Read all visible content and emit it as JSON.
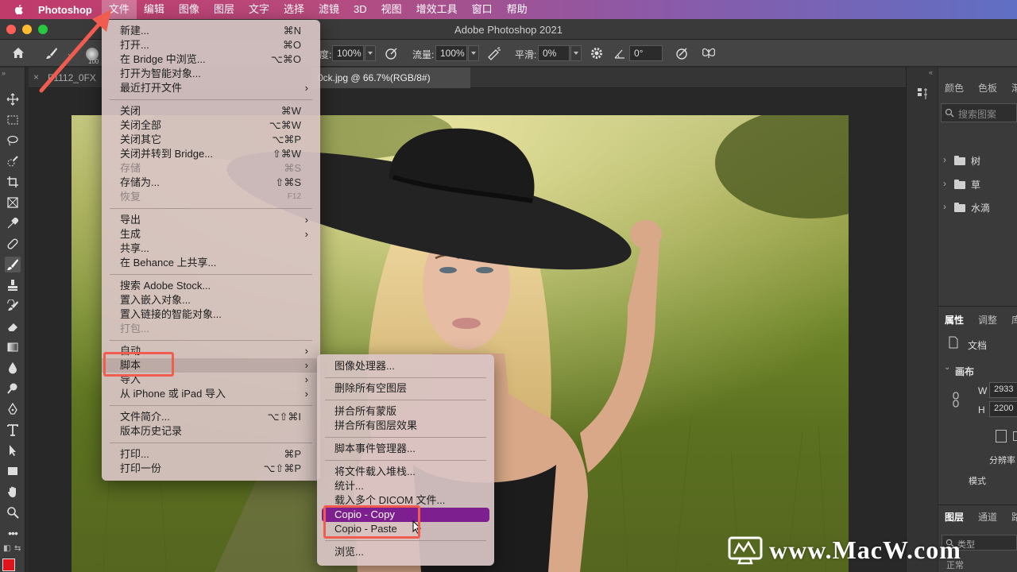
{
  "menubar": {
    "app_name": "Photoshop",
    "items": [
      "文件",
      "编辑",
      "图像",
      "图层",
      "文字",
      "选择",
      "滤镜",
      "3D",
      "视图",
      "增效工具",
      "窗口",
      "帮助"
    ],
    "active_item": "文件"
  },
  "window": {
    "title": "Adobe Photoshop 2021"
  },
  "options_bar": {
    "brush_size": "100",
    "opacity_label": "度:",
    "opacity_value": "100%",
    "flow_label": "流量:",
    "flow_value": "100%",
    "smoothing_label": "平滑:",
    "smoothing_value": "0%",
    "angle_value": "0°"
  },
  "tabs": [
    {
      "label": "F1112_0FX",
      "active": false
    },
    {
      "label": "0ck.jpg @ 66.7%(RGB/8#)",
      "active": true
    }
  ],
  "file_menu": {
    "items": [
      {
        "label": "新建...",
        "shortcut": "⌘N"
      },
      {
        "label": "打开...",
        "shortcut": "⌘O"
      },
      {
        "label": "在 Bridge 中浏览...",
        "shortcut": "⌥⌘O"
      },
      {
        "label": "打开为智能对象...",
        "shortcut": ""
      },
      {
        "label": "最近打开文件",
        "shortcut": "",
        "submenu": true
      },
      {
        "label": "关闭",
        "shortcut": "⌘W"
      },
      {
        "label": "关闭全部",
        "shortcut": "⌥⌘W"
      },
      {
        "label": "关闭其它",
        "shortcut": "⌥⌘P"
      },
      {
        "label": "关闭并转到 Bridge...",
        "shortcut": "⇧⌘W"
      },
      {
        "label": "存储",
        "shortcut": "⌘S",
        "disabled": true
      },
      {
        "label": "存储为...",
        "shortcut": "⇧⌘S"
      },
      {
        "label": "恢复",
        "shortcut": "F12",
        "disabled": true
      },
      {
        "label": "导出",
        "shortcut": "",
        "submenu": true
      },
      {
        "label": "生成",
        "shortcut": "",
        "submenu": true
      },
      {
        "label": "共享...",
        "shortcut": ""
      },
      {
        "label": "在 Behance 上共享...",
        "shortcut": ""
      },
      {
        "label": "搜索 Adobe Stock...",
        "shortcut": ""
      },
      {
        "label": "置入嵌入对象...",
        "shortcut": ""
      },
      {
        "label": "置入链接的智能对象...",
        "shortcut": ""
      },
      {
        "label": "打包...",
        "shortcut": "",
        "disabled": true
      },
      {
        "label": "自动",
        "shortcut": "",
        "submenu": true
      },
      {
        "label": "脚本",
        "shortcut": "",
        "submenu": true,
        "highlighted": true
      },
      {
        "label": "导入",
        "shortcut": "",
        "submenu": true
      },
      {
        "label": "从 iPhone 或 iPad 导入",
        "shortcut": "",
        "submenu": true
      },
      {
        "label": "文件简介...",
        "shortcut": "⌥⇧⌘I"
      },
      {
        "label": "版本历史记录",
        "shortcut": ""
      },
      {
        "label": "打印...",
        "shortcut": "⌘P"
      },
      {
        "label": "打印一份",
        "shortcut": "⌥⇧⌘P"
      }
    ]
  },
  "scripts_submenu": {
    "items": [
      {
        "label": "图像处理器..."
      },
      {
        "label": "删除所有空图层"
      },
      {
        "label": "拼合所有蒙版"
      },
      {
        "label": "拼合所有图层效果"
      },
      {
        "label": "脚本事件管理器..."
      },
      {
        "label": "将文件载入堆栈..."
      },
      {
        "label": "统计..."
      },
      {
        "label": "载入多个 DICOM 文件..."
      },
      {
        "label": "Copio - Copy",
        "selected": true
      },
      {
        "label": "Copio - Paste"
      },
      {
        "label": "浏览..."
      }
    ]
  },
  "right_panel": {
    "top_tabs": [
      "颜色",
      "色板",
      "渐"
    ],
    "search_placeholder": "搜索图案",
    "folders": [
      "树",
      "草",
      "水滴"
    ],
    "props_tabs": [
      "属性",
      "调整",
      "库"
    ],
    "doc_label": "文档",
    "canvas_label": "画布",
    "w_label": "W",
    "w_value": "2933",
    "h_label": "H",
    "h_value": "2200",
    "resolution_label": "分辨率",
    "mode_label": "模式",
    "layers_tabs": [
      "图层",
      "通道",
      "路"
    ],
    "kind_label": "类型",
    "blend_label": "正常"
  },
  "watermark": {
    "text": "www.MacW.com"
  },
  "colors": {
    "menu_highlight": "#7d1f8f",
    "annotation_red": "#f05c4f"
  }
}
